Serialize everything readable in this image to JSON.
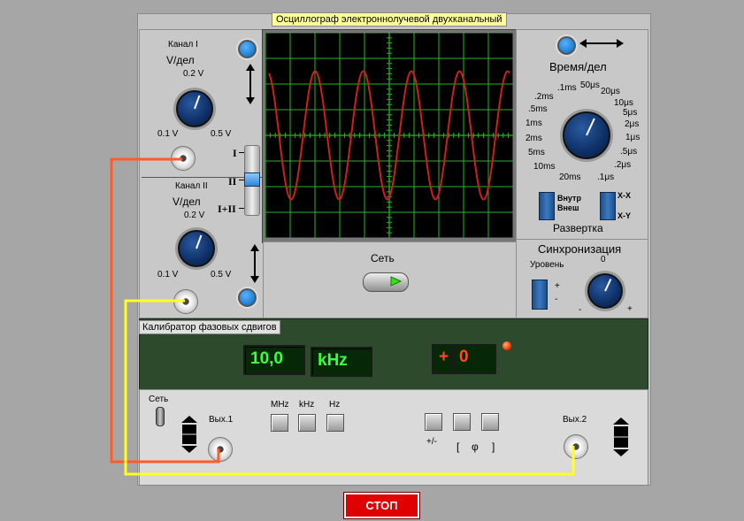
{
  "window": {
    "title": "Осциллограф электроннолучевой двухканальный"
  },
  "channel1": {
    "label": "Канал I",
    "units": "V/дел",
    "ticks": [
      "0.2 V",
      "0.1 V",
      "0.5 V"
    ]
  },
  "channel2": {
    "label": "Канал II",
    "units": "V/дел",
    "ticks": [
      "0.2 V",
      "0.1 V",
      "0.5 V"
    ]
  },
  "mode_switch": {
    "options": [
      "I",
      "II",
      "I+II"
    ],
    "selected": "II"
  },
  "timebase": {
    "title": "Время/дел",
    "ticks": [
      "50μs",
      "20μs",
      "10μs",
      "5μs",
      "2μs",
      "1μs",
      ".5μs",
      ".2μs",
      ".1μs",
      ".1ms",
      ".2ms",
      ".5ms",
      "1ms",
      "2ms",
      "5ms",
      "10ms",
      "20ms"
    ],
    "internal_external": "Внутр\nВнеш",
    "xx": "X-X",
    "xy": "X-Y",
    "sweep_label": "Развертка"
  },
  "sync": {
    "title": "Синхронизация",
    "level_label": "Уровень",
    "zero": "0",
    "plus": "+",
    "minus": "-",
    "switch_plus": "+",
    "switch_minus": "-"
  },
  "power": {
    "label": "Сеть"
  },
  "calibrator": {
    "title": "Калибратор фазовых сдвигов",
    "frequency_value": "10,0",
    "frequency_unit": "kHz",
    "phase_sign": "+",
    "phase_value": "0",
    "power_label": "Сеть",
    "out1_label": "Вых.1",
    "out2_label": "Вых.2",
    "range_buttons": [
      "MHz",
      "kHz",
      "Hz"
    ],
    "phase_buttons_label1": "+/-",
    "phase_buttons_label2": "[",
    "phase_buttons_label3": "φ",
    "phase_buttons_label4": "]"
  },
  "stop_button": {
    "label": "СТОП"
  },
  "colors": {
    "trace": "#cc1f1f",
    "grid": "#28b428",
    "screen": "#000000",
    "lcd_text": "#3dff3d",
    "stop_bg": "#e00000",
    "wire_red": "#ff5a2a",
    "wire_yellow": "#ffff22"
  },
  "chart_data": {
    "type": "line",
    "title": "",
    "xlabel": "",
    "ylabel": "",
    "series": [
      {
        "shape": "sine",
        "cycles": 5,
        "amplitude_divisions": 2.5
      }
    ],
    "grid": true
  }
}
